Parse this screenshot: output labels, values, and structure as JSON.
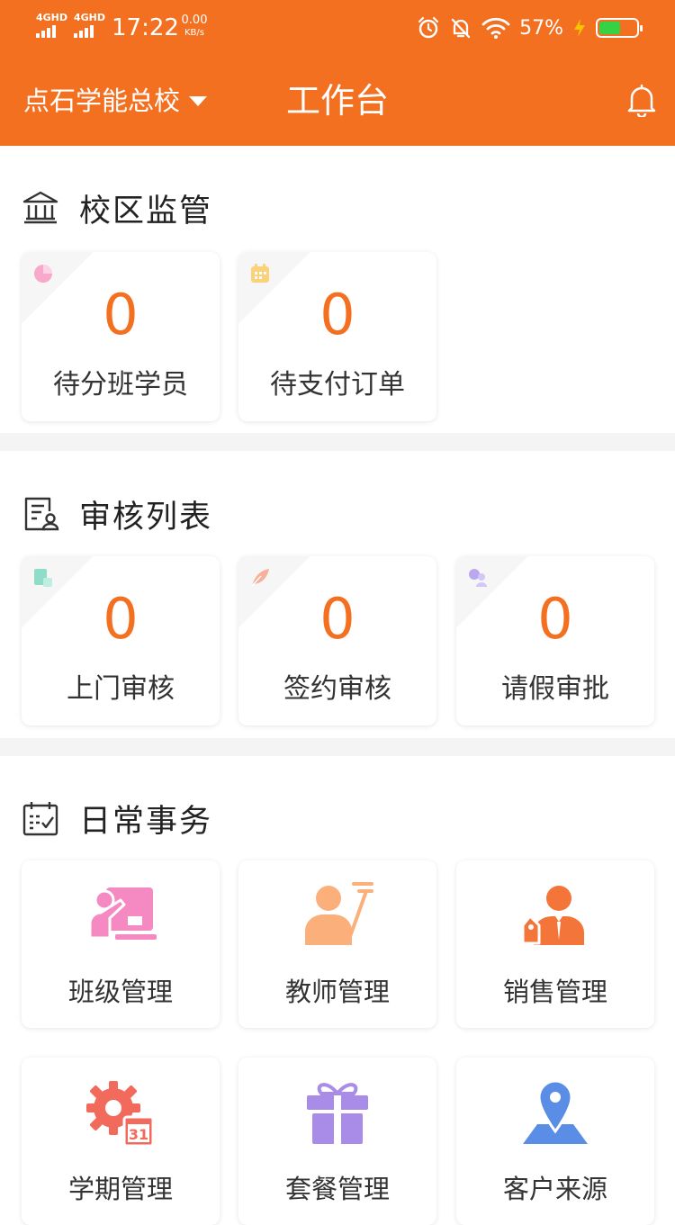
{
  "status_bar": {
    "net1": "4GHD",
    "net2": "4GHD",
    "time": "17:22",
    "speed_value": "0.00",
    "speed_unit": "KB/s",
    "battery": "57%"
  },
  "header": {
    "school": "点石学能总校",
    "title": "工作台"
  },
  "campus": {
    "title": "校区监管",
    "cards": [
      {
        "value": "0",
        "label": "待分班学员"
      },
      {
        "value": "0",
        "label": "待支付订单"
      }
    ]
  },
  "review": {
    "title": "审核列表",
    "cards": [
      {
        "value": "0",
        "label": "上门审核"
      },
      {
        "value": "0",
        "label": "签约审核"
      },
      {
        "value": "0",
        "label": "请假审批"
      }
    ]
  },
  "daily": {
    "title": "日常事务",
    "tiles": [
      {
        "label": "班级管理"
      },
      {
        "label": "教师管理"
      },
      {
        "label": "销售管理"
      },
      {
        "label": "学期管理",
        "badge": "31"
      },
      {
        "label": "套餐管理"
      },
      {
        "label": "客户来源"
      }
    ]
  },
  "colors": {
    "brand": "#f47021",
    "pink": "#f589c2",
    "peach": "#fbb07c",
    "orange": "#f4753a",
    "coral": "#f26a5b",
    "purple": "#a98be8",
    "blue": "#5a8ee6"
  }
}
